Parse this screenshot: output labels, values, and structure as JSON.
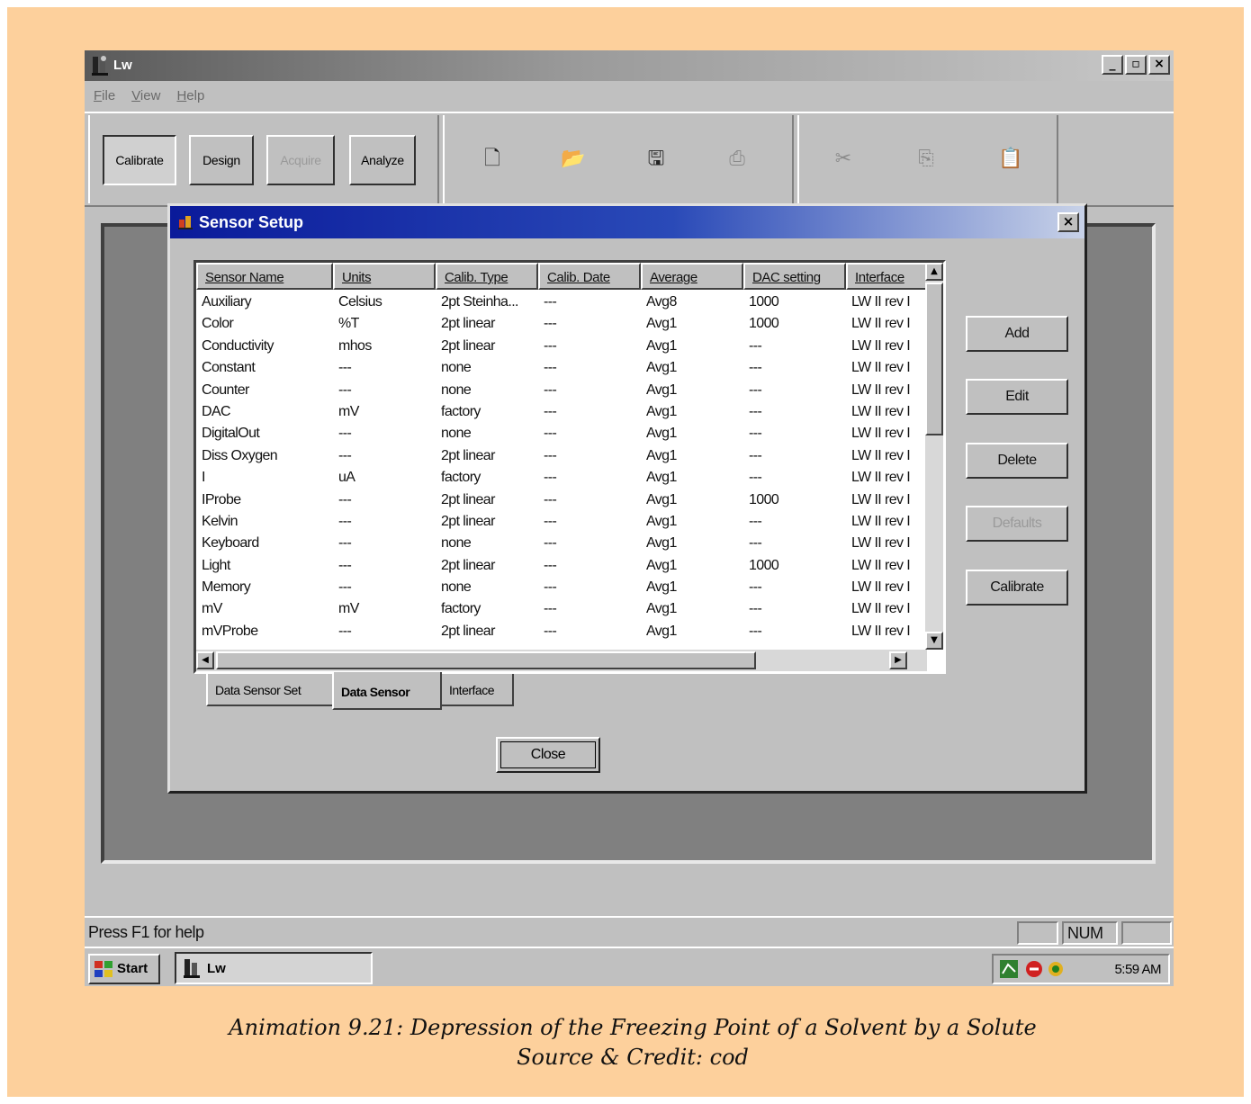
{
  "window": {
    "title": "Lw",
    "controls": {
      "minimize": "_",
      "maximize": "▫",
      "close": "×"
    }
  },
  "menu": [
    "File",
    "View",
    "Help"
  ],
  "toolbar": {
    "buttons": [
      {
        "label": "Calibrate",
        "enabled": true
      },
      {
        "label": "Design",
        "enabled": true
      },
      {
        "label": "Acquire",
        "enabled": false
      },
      {
        "label": "Analyze",
        "enabled": true
      }
    ],
    "file_icons": [
      "new-file-icon",
      "open-folder-icon",
      "save-icon",
      "print-preview-icon"
    ],
    "edit_icons": [
      "cut-icon",
      "copy-icon",
      "paste-icon"
    ]
  },
  "dialog": {
    "title": "Sensor Setup",
    "close": "×",
    "columns": [
      "Sensor Name",
      "Units",
      "Calib. Type",
      "Calib. Date",
      "Average",
      "DAC setting",
      "Interface"
    ],
    "rows": [
      [
        "Auxiliary",
        "Celsius",
        "2pt Steinha...",
        "---",
        "Avg8",
        "1000",
        "LW II rev I"
      ],
      [
        "Color",
        "%T",
        "2pt linear",
        "---",
        "Avg1",
        "1000",
        "LW II rev I"
      ],
      [
        "Conductivity",
        "mhos",
        "2pt linear",
        "---",
        "Avg1",
        "---",
        "LW II rev I"
      ],
      [
        "Constant",
        "---",
        "none",
        "---",
        "Avg1",
        "---",
        "LW II rev I"
      ],
      [
        "Counter",
        "---",
        "none",
        "---",
        "Avg1",
        "---",
        "LW II rev I"
      ],
      [
        "DAC",
        "mV",
        "factory",
        "---",
        "Avg1",
        "---",
        "LW II rev I"
      ],
      [
        "DigitalOut",
        "---",
        "none",
        "---",
        "Avg1",
        "---",
        "LW II rev I"
      ],
      [
        "Diss Oxygen",
        "---",
        "2pt linear",
        "---",
        "Avg1",
        "---",
        "LW II rev I"
      ],
      [
        "I",
        "uA",
        "factory",
        "---",
        "Avg1",
        "---",
        "LW II rev I"
      ],
      [
        "IProbe",
        "---",
        "2pt linear",
        "---",
        "Avg1",
        "1000",
        "LW II rev I"
      ],
      [
        "Kelvin",
        "---",
        "2pt linear",
        "---",
        "Avg1",
        "---",
        "LW II rev I"
      ],
      [
        "Keyboard",
        "---",
        "none",
        "---",
        "Avg1",
        "---",
        "LW II rev I"
      ],
      [
        "Light",
        "---",
        "2pt linear",
        "---",
        "Avg1",
        "1000",
        "LW II rev I"
      ],
      [
        "Memory",
        "---",
        "none",
        "---",
        "Avg1",
        "---",
        "LW II rev I"
      ],
      [
        "mV",
        "mV",
        "factory",
        "---",
        "Avg1",
        "---",
        "LW II rev I"
      ],
      [
        "mVProbe",
        "---",
        "2pt linear",
        "---",
        "Avg1",
        "---",
        "LW II rev I"
      ]
    ],
    "side_buttons": [
      {
        "label": "Add",
        "enabled": true
      },
      {
        "label": "Edit",
        "enabled": true
      },
      {
        "label": "Delete",
        "enabled": true
      },
      {
        "label": "Defaults",
        "enabled": false
      },
      {
        "label": "Calibrate",
        "enabled": true
      }
    ],
    "tabs": [
      "Data Sensor Set",
      "Data Sensor",
      "Interface"
    ],
    "active_tab": "Data Sensor",
    "close_button": "Close",
    "scroll": {
      "up": "▲",
      "down": "▼",
      "left": "◀",
      "right": "▶"
    }
  },
  "statusbar": {
    "help_text": "Press F1 for help",
    "num": "NUM"
  },
  "taskbar": {
    "start": "Start",
    "task": "Lw",
    "clock": "5:59 AM"
  },
  "caption": {
    "line1": "Animation 9.21: Depression of the Freezing Point of a Solvent by a Solute",
    "line2": "Source & Credit: cod"
  }
}
